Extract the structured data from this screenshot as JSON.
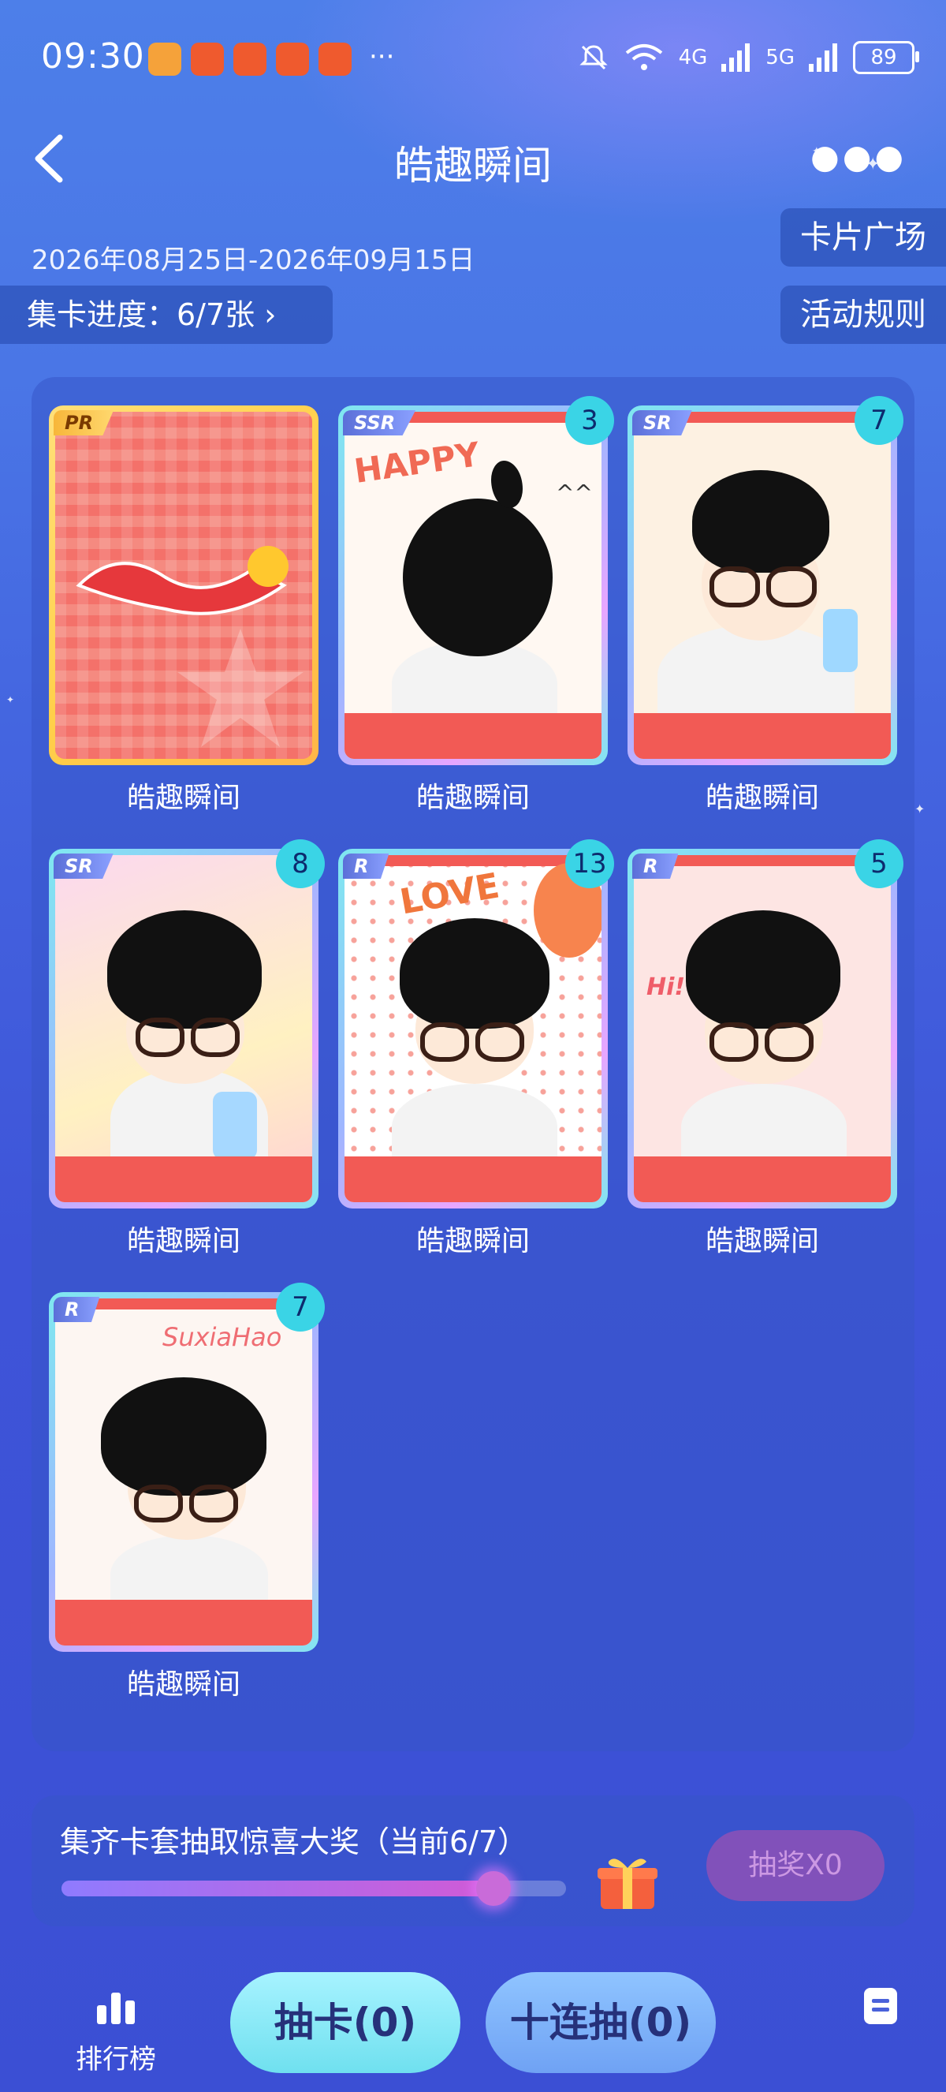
{
  "status_bar": {
    "time": "09:30",
    "network1": "4G",
    "network2": "5G",
    "battery": "89"
  },
  "header": {
    "title": "皓趣瞬间",
    "back_icon": "chevron-left-icon",
    "more_icon": "more-dots-icon"
  },
  "activity": {
    "date_range": "2026年08月25日-2026年09月15日",
    "collection_progress": "集卡进度：6/7张 ›",
    "card_plaza": "卡片广场",
    "rules": "活动规则"
  },
  "cards": [
    {
      "rarity": "PR",
      "count": "",
      "name": "皓趣瞬间"
    },
    {
      "rarity": "SSR",
      "count": "3",
      "name": "皓趣瞬间"
    },
    {
      "rarity": "SR",
      "count": "7",
      "name": "皓趣瞬间"
    },
    {
      "rarity": "SR",
      "count": "8",
      "name": "皓趣瞬间"
    },
    {
      "rarity": "R",
      "count": "13",
      "name": "皓趣瞬间"
    },
    {
      "rarity": "R",
      "count": "5",
      "name": "皓趣瞬间"
    },
    {
      "rarity": "R",
      "count": "7",
      "name": "皓趣瞬间"
    }
  ],
  "card_art_text": {
    "happy": "HAPPY",
    "love": "LOVE",
    "hi": "Hi!",
    "signature": "SuxiaHao",
    "carets": "^^"
  },
  "prize": {
    "text": "集齐卡套抽取惊喜大奖（当前6/7）",
    "progress": 0.857,
    "draw_button": "抽奖X0"
  },
  "bottom_nav": {
    "ranking": "排行榜",
    "draw_card": "抽卡(0)",
    "ten_draw": "十连抽(0)",
    "record_icon": "document-icon"
  },
  "colors": {
    "accent_cyan": "#3ad4e6",
    "card_red": "#f25a55",
    "panel": "#3a55c8"
  }
}
